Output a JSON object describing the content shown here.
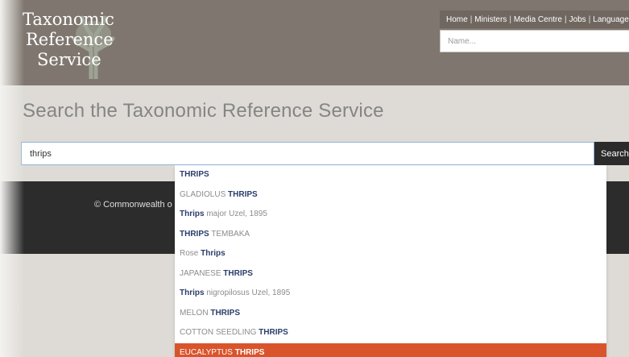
{
  "header": {
    "logo_lines": [
      "Taxonomic",
      "Reference",
      "Service"
    ],
    "nav_items": [
      "Home",
      "Ministers",
      "Media Centre",
      "Jobs",
      "Languages"
    ],
    "name_search_placeholder": "Name..."
  },
  "main": {
    "title": "Search the Taxonomic Reference Service",
    "search_value": "thrips",
    "search_button_label": "Search"
  },
  "footer": {
    "copyright": "© Commonwealth o"
  },
  "autocomplete": {
    "highlight_color": "#d9542b",
    "items": [
      {
        "pre": "",
        "match": "THRIPS",
        "post": ""
      },
      {
        "pre": "GLADIOLUS ",
        "match": "THRIPS",
        "post": ""
      },
      {
        "pre": "",
        "match": "Thrips",
        "post": " major Uzel, 1895"
      },
      {
        "pre": "",
        "match": "THRIPS",
        "post": " TEMBAKA"
      },
      {
        "pre": "Rose ",
        "match": "Thrips",
        "post": ""
      },
      {
        "pre": "JAPANESE ",
        "match": "THRIPS",
        "post": ""
      },
      {
        "pre": "",
        "match": "Thrips",
        "post": " nigropilosus Uzel, 1895"
      },
      {
        "pre": "MELON ",
        "match": "THRIPS",
        "post": ""
      },
      {
        "pre": "COTTON SEEDLING ",
        "match": "THRIPS",
        "post": ""
      },
      {
        "pre": "EUCALYPTUS ",
        "match": "THRIPS",
        "post": ""
      }
    ],
    "active_index": 9
  }
}
